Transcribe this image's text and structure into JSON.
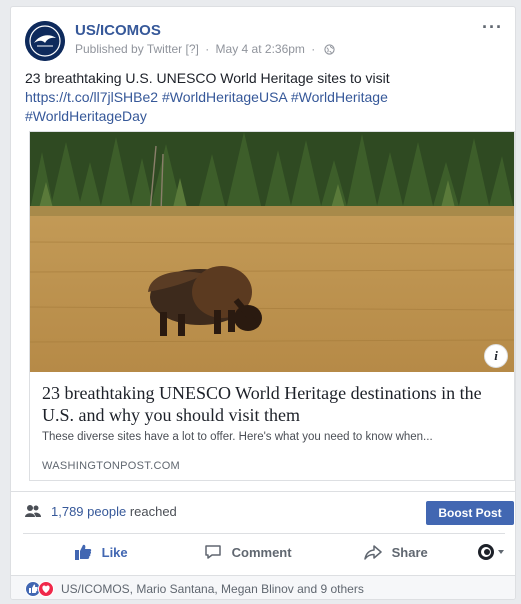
{
  "post": {
    "page_name": "US/ICOMOS",
    "published_by": "Published by Twitter",
    "help_mark": "[?]",
    "separator": "·",
    "timestamp": "May 4 at 2:36pm",
    "privacy_icon": "globe-icon",
    "more_icon": "ellipsis-icon",
    "text": "23 breathtaking U.S. UNESCO World Heritage sites to visit",
    "link_line1": "https://t.co/ll7jlSHBe2 #WorldHeritageUSA #WorldHeritage",
    "link_line2": "#WorldHeritageDay"
  },
  "share": {
    "image_subject": "bison grazing in a golden meadow with pine forest",
    "info_badge": "i",
    "title": "23 breathtaking UNESCO World Heritage destinations in the U.S. and why you should visit them",
    "description": "These diverse sites have a lot to offer. Here's what you need to know when...",
    "domain": "WASHINGTONPOST.COM"
  },
  "insights": {
    "reach_count": "1,789 people",
    "reach_suffix": "reached",
    "boost_label": "Boost Post"
  },
  "actions": {
    "like": "Like",
    "comment": "Comment",
    "share": "Share"
  },
  "footer": {
    "reactors": "US/ICOMOS, Mario Santana, Megan Blinov and 9 others"
  },
  "colors": {
    "brand_blue": "#4267b2",
    "link_blue": "#365899",
    "love_red": "#f0284a",
    "background": "#e9ebee"
  }
}
